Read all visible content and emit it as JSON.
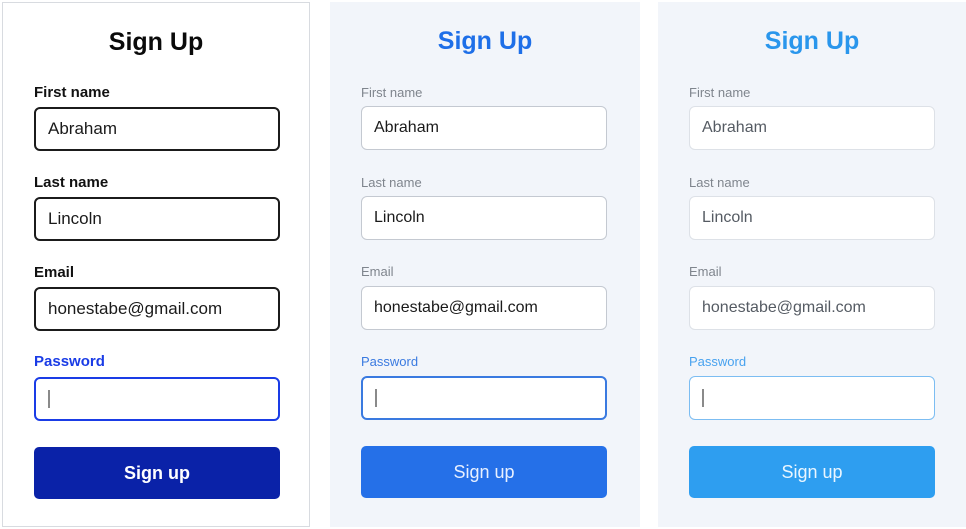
{
  "forms": [
    {
      "title": "Sign Up",
      "first_name_label": "First name",
      "first_name_value": "Abraham",
      "last_name_label": "Last name",
      "last_name_value": "Lincoln",
      "email_label": "Email",
      "email_value": "honestabe@gmail.com",
      "password_label": "Password",
      "submit_label": "Sign up"
    },
    {
      "title": "Sign Up",
      "first_name_label": "First name",
      "first_name_value": "Abraham",
      "last_name_label": "Last name",
      "last_name_value": "Lincoln",
      "email_label": "Email",
      "email_value": "honestabe@gmail.com",
      "password_label": "Password",
      "submit_label": "Sign up"
    },
    {
      "title": "Sign Up",
      "first_name_label": "First name",
      "first_name_value": "Abraham",
      "last_name_label": "Last name",
      "last_name_value": "Lincoln",
      "email_label": "Email",
      "email_value": "honestabe@gmail.com",
      "password_label": "Password",
      "submit_label": "Sign up"
    }
  ],
  "colors": {
    "high_contrast_button": "#0a22a8",
    "medium_button": "#2570e8",
    "low_contrast_button": "#2e9ef0",
    "focus_blue": "#1a3ce6"
  }
}
